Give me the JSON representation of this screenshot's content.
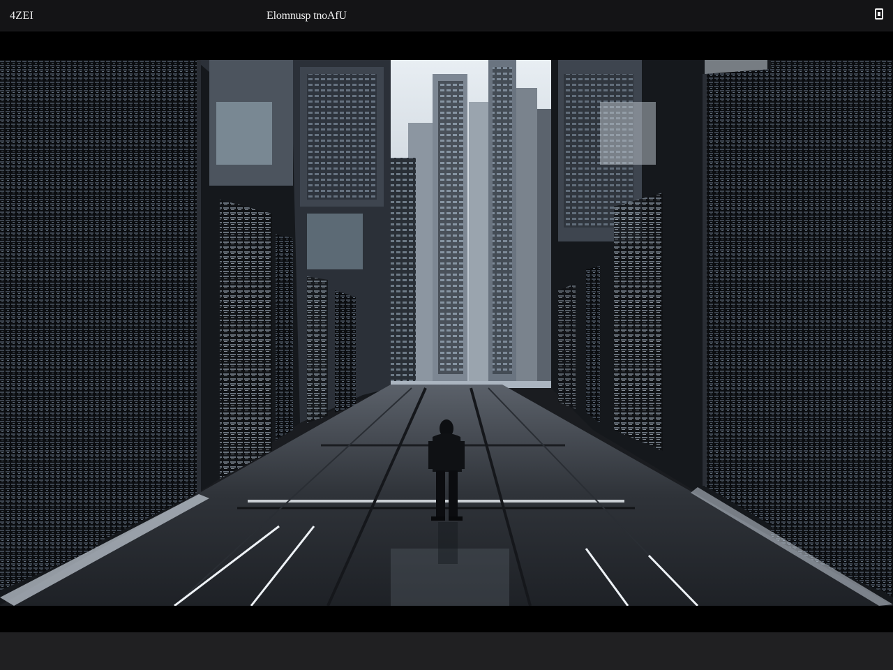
{
  "window": {
    "left_label": "4ZEI",
    "title": "Elomnusp tnoAfU",
    "window_button_icon": "window-restore-icon"
  },
  "viewer": {
    "image_subject": "futuristic-city-alley-with-figure",
    "colors": {
      "sky": "#dfe6ec",
      "wall_dark": "#0f1114",
      "floor": "#3b3f46",
      "accent_light": "#e9eef5"
    }
  }
}
